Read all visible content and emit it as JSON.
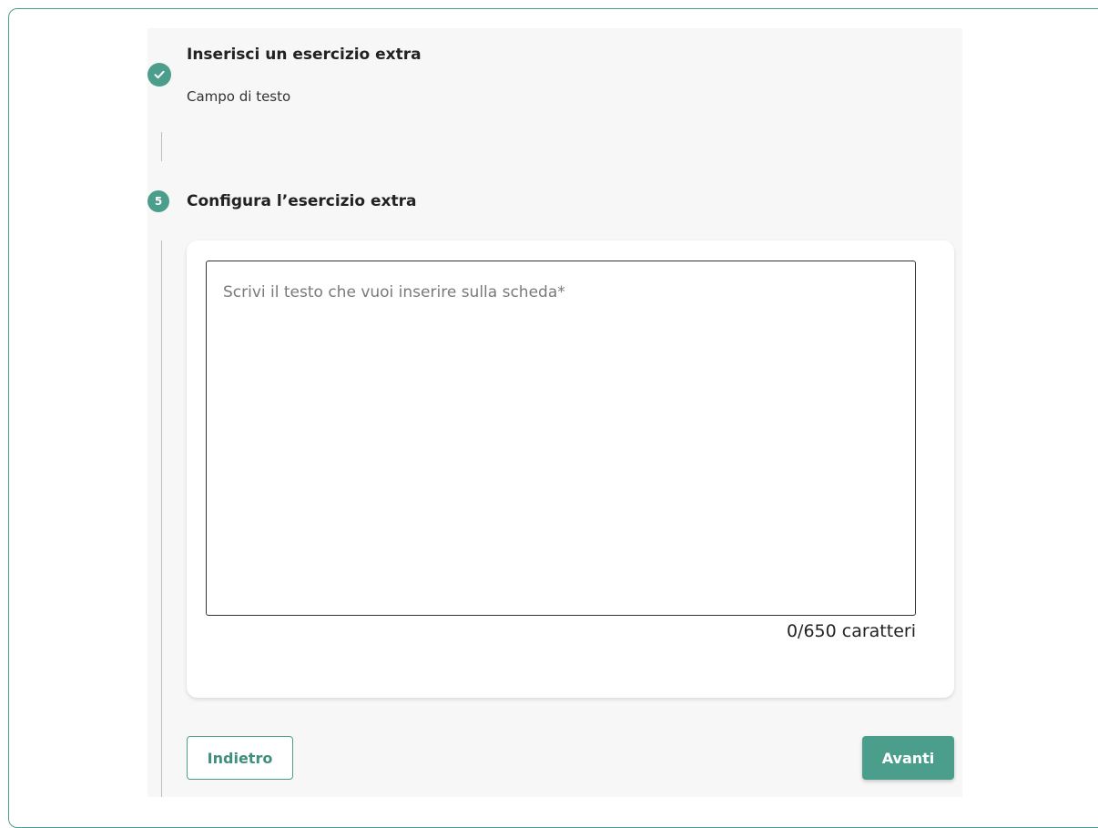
{
  "colors": {
    "accent": "#4a9e8b",
    "panel_bg": "#f7f7f7",
    "card_bg": "#ffffff"
  },
  "steps": [
    {
      "status": "completed",
      "icon": "check-icon",
      "title": "Inserisci un esercizio extra",
      "subtitle": "Campo di testo"
    },
    {
      "status": "active",
      "number": "5",
      "title": "Configura l’esercizio extra"
    }
  ],
  "editor": {
    "value": "",
    "placeholder": "Scrivi il testo che vuoi inserire sulla scheda*",
    "counter": "0/650 caratteri"
  },
  "actions": {
    "back_label": "Indietro",
    "next_label": "Avanti"
  }
}
